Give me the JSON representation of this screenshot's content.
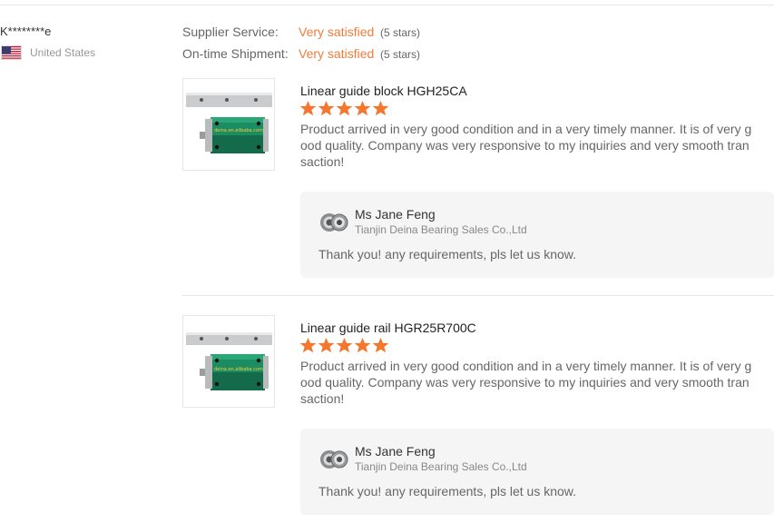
{
  "buyer": {
    "name": "K********e",
    "country": "United States"
  },
  "ratings": [
    {
      "label": "Supplier Service:",
      "value": "Very satisfied",
      "stars": "(5 stars)"
    },
    {
      "label": "On-time Shipment:",
      "value": "Very satisfied",
      "stars": "(5 stars)"
    }
  ],
  "reviews": [
    {
      "product_title": "Linear guide block HGH25CA",
      "star_count": 5,
      "text": "Product arrived in very good condition and in a very timely manner.  It is of very good quality.  Company was very responsive to my inquiries and very smooth transaction!",
      "image_watermark": "deina.en.alibaba.com",
      "reply": {
        "name": "Ms Jane Feng",
        "company": "Tianjin Deina Bearing Sales Co.,Ltd",
        "text": "Thank you! any  requirements, pls let us know."
      }
    },
    {
      "product_title": "Linear guide rail HGR25R700C",
      "star_count": 5,
      "text": "Product arrived in very good condition and in a very timely manner.  It is of very good quality.  Company was very responsive to my inquiries and very smooth transaction!",
      "image_watermark": "deina.en.alibaba.com",
      "reply": {
        "name": "Ms Jane Feng",
        "company": "Tianjin Deina Bearing Sales Co.,Ltd",
        "text": "Thank you! any  requirements, pls let us know."
      }
    }
  ],
  "colors": {
    "accent_orange": "#f07c3c",
    "star_orange": "#f5762c",
    "reply_bg": "#f5f5f5"
  },
  "icons": {
    "flag": "us-flag-icon",
    "star": "star-icon",
    "avatar": "bearing-avatar-icon"
  }
}
